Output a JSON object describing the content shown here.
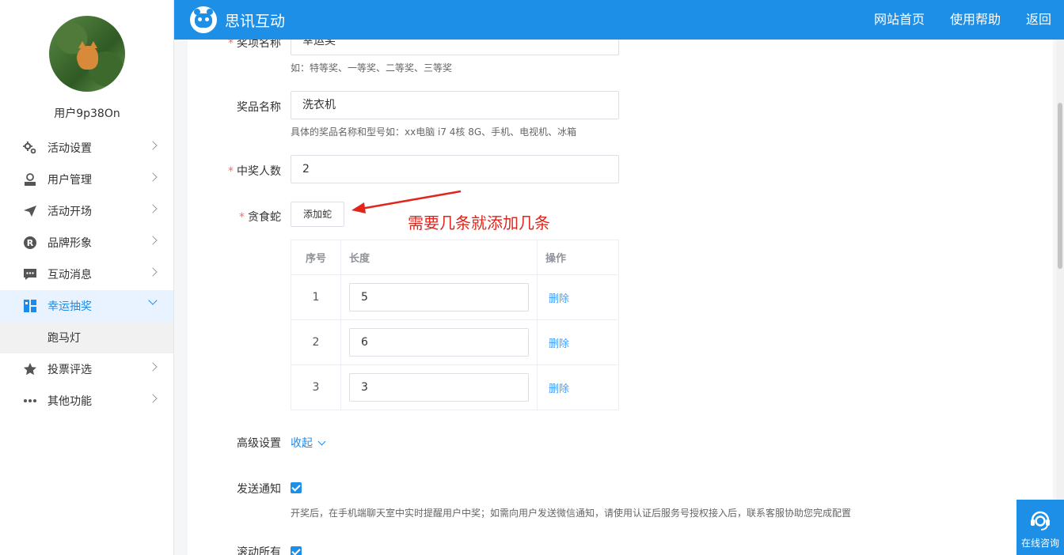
{
  "sidebar": {
    "username": "用户9p38On",
    "items": [
      {
        "label": "活动设置",
        "icon": "gears-icon"
      },
      {
        "label": "用户管理",
        "icon": "user-manage-icon"
      },
      {
        "label": "活动开场",
        "icon": "paper-plane-icon"
      },
      {
        "label": "品牌形象",
        "icon": "registered-icon"
      },
      {
        "label": "互动消息",
        "icon": "message-icon"
      },
      {
        "label": "幸运抽奖",
        "icon": "lottery-icon",
        "active": true
      },
      {
        "label": "投票评选",
        "icon": "star-icon"
      },
      {
        "label": "其他功能",
        "icon": "more-icon"
      }
    ],
    "submenu": {
      "label": "跑马灯"
    }
  },
  "header": {
    "brand": "思讯互动",
    "nav": [
      "网站首页",
      "使用帮助",
      "返回"
    ]
  },
  "form": {
    "prize_level": {
      "label": "奖项名称",
      "value": "幸运奖",
      "hint": "如：特等奖、一等奖、二等奖、三等奖"
    },
    "prize_name": {
      "label": "奖品名称",
      "value": "洗衣机",
      "hint": "具体的奖品名称和型号如：xx电脑 i7 4核 8G、手机、电视机、冰箱"
    },
    "winner_count": {
      "label": "中奖人数",
      "value": "2"
    },
    "snake": {
      "label": "贪食蛇",
      "add_button": "添加蛇",
      "annotation": "需要几条就添加几条"
    },
    "table": {
      "headers": [
        "序号",
        "长度",
        "操作"
      ],
      "rows": [
        {
          "index": "1",
          "length": "5",
          "action": "删除"
        },
        {
          "index": "2",
          "length": "6",
          "action": "删除"
        },
        {
          "index": "3",
          "length": "3",
          "action": "删除"
        }
      ]
    },
    "advanced": {
      "label": "高级设置",
      "toggle": "收起"
    },
    "notify": {
      "label": "发送通知",
      "checked": true,
      "hint": "开奖后，在手机端聊天室中实时提醒用户中奖；如需向用户发送微信通知，请使用认证后服务号授权接入后，联系客服协助您完成配置"
    },
    "scroll_all": {
      "label": "滚动所有",
      "checked": true
    }
  },
  "chat_widget": {
    "label": "在线咨询",
    "icon": "headset-icon"
  },
  "colors": {
    "primary": "#1e8fe6",
    "link": "#409eff",
    "required": "#f56c6c",
    "annotation": "#e1251b"
  }
}
